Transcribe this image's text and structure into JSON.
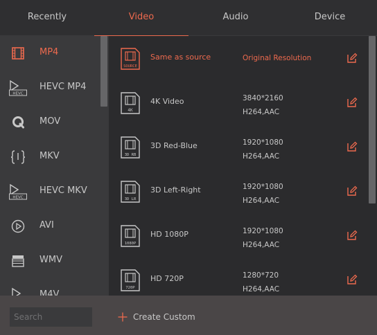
{
  "tabs": [
    {
      "label": "Recently"
    },
    {
      "label": "Video"
    },
    {
      "label": "Audio"
    },
    {
      "label": "Device"
    }
  ],
  "active_tab": "Video",
  "sidebar": {
    "items": [
      {
        "label": "MP4",
        "icon": "film-icon",
        "active": true
      },
      {
        "label": "HEVC MP4",
        "icon": "hevc-icon"
      },
      {
        "label": "MOV",
        "icon": "quicktime-icon"
      },
      {
        "label": "MKV",
        "icon": "mkv-icon"
      },
      {
        "label": "HEVC MKV",
        "icon": "hevc-icon"
      },
      {
        "label": "AVI",
        "icon": "play-circle-icon"
      },
      {
        "label": "WMV",
        "icon": "clapperboard-icon"
      },
      {
        "label": "M4V",
        "icon": "play-icon"
      }
    ]
  },
  "presets": [
    {
      "name": "Same as source",
      "badge": "SOURCE",
      "res_line1": "Original Resolution",
      "res_line2": "",
      "active": true
    },
    {
      "name": "4K Video",
      "badge": "4K",
      "res_line1": "3840*2160",
      "res_line2": "H264,AAC"
    },
    {
      "name": "3D Red-Blue",
      "badge": "3D RB",
      "res_line1": "1920*1080",
      "res_line2": "H264,AAC"
    },
    {
      "name": "3D Left-Right",
      "badge": "3D LR",
      "res_line1": "1920*1080",
      "res_line2": "H264,AAC"
    },
    {
      "name": "HD 1080P",
      "badge": "1080P",
      "res_line1": "1920*1080",
      "res_line2": "H264,AAC"
    },
    {
      "name": "HD 720P",
      "badge": "720P",
      "res_line1": "1280*720",
      "res_line2": "H264,AAC"
    }
  ],
  "footer": {
    "search_placeholder": "Search",
    "create_label": "Create Custom"
  },
  "colors": {
    "accent": "#ee6a4e",
    "text": "#c8c8c8",
    "sidebar_bg": "#3a3a3c",
    "list_bg": "#2b2b2d",
    "footer_bg": "#4a4647"
  }
}
